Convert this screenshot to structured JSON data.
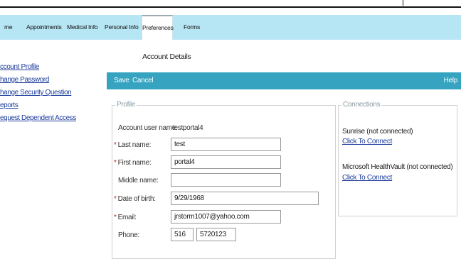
{
  "nav": {
    "tabs": [
      {
        "label": "me"
      },
      {
        "label": "Appointments"
      },
      {
        "label": "Medical Info"
      },
      {
        "label": "Personal Info"
      },
      {
        "label": "Preferences",
        "active": true
      },
      {
        "label": "Forms"
      }
    ]
  },
  "sidebar": {
    "items": [
      {
        "label": "ccount Profile"
      },
      {
        "label": "hange Password"
      },
      {
        "label": "hange Security Question"
      },
      {
        "label": "eports"
      },
      {
        "label": "equest Dependent Access"
      }
    ]
  },
  "section_title": "Account Details",
  "toolbar": {
    "save_label": "Save",
    "cancel_label": "Cancel",
    "help_label": "Help"
  },
  "profile": {
    "legend": "Profile",
    "account_user_name_label": "Account user name:",
    "account_user_name": "testportal4",
    "last_name_label": "Last name:",
    "last_name": "test",
    "first_name_label": "First name:",
    "first_name": "portal4",
    "middle_name_label": "Middle name:",
    "middle_name": "",
    "dob_label": "Date of birth:",
    "dob": "9/29/1968",
    "email_label": "Email:",
    "email": "jrstorm1007@yahoo.com",
    "phone_label": "Phone:",
    "phone_area": "516",
    "phone_number": "5720123"
  },
  "connections": {
    "legend": "Connections",
    "items": [
      {
        "name": "Sunrise  (not connected)",
        "link": "Click To Connect"
      },
      {
        "name": "Microsoft HealthVault  (not connected)",
        "link": "Click To Connect"
      }
    ]
  },
  "colors": {
    "nav_bg": "#b6e5f3",
    "toolbar_bg": "#36a4c0",
    "link": "#1b3c9c",
    "required": "#c02020"
  }
}
